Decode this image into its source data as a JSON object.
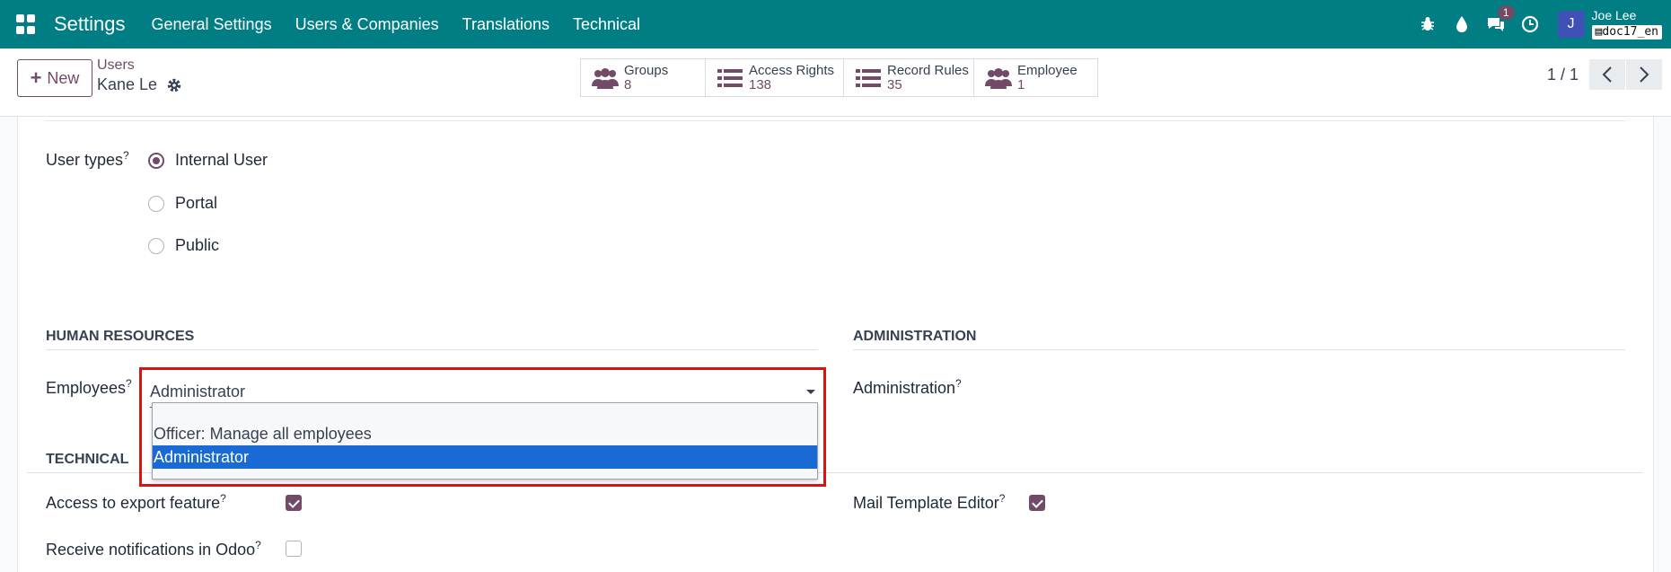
{
  "topbar": {
    "app_title": "Settings",
    "menu": [
      "General Settings",
      "Users & Companies",
      "Translations",
      "Technical"
    ],
    "chat_badge": "1",
    "avatar_letter": "J",
    "user_name": "Joe Lee",
    "db_name": "doc17_en"
  },
  "control": {
    "new_label": "New",
    "breadcrumb_parent": "Users",
    "breadcrumb_current": "Kane Le",
    "smart_buttons": [
      {
        "label": "Groups",
        "value": "8",
        "icon": "users-icon"
      },
      {
        "label": "Access Rights",
        "value": "138",
        "icon": "list-icon"
      },
      {
        "label": "Record Rules",
        "value": "35",
        "icon": "list-icon"
      },
      {
        "label": "Employee",
        "value": "1",
        "icon": "users-icon"
      }
    ],
    "pager": "1 / 1"
  },
  "form": {
    "user_types_label": "User types",
    "user_types_help": "?",
    "user_types": [
      {
        "label": "Internal User",
        "checked": true
      },
      {
        "label": "Portal",
        "checked": false
      },
      {
        "label": "Public",
        "checked": false
      }
    ],
    "hr_section": "HUMAN RESOURCES",
    "admin_section": "ADMINISTRATION",
    "employees_label": "Employees",
    "employees_value": "Administrator",
    "employees_options": [
      "",
      "Officer: Manage all employees",
      "Administrator"
    ],
    "administration_label": "Administration",
    "technical_section": "TECHNICAL",
    "export_label": "Access to export feature",
    "notify_label": "Receive notifications in Odoo",
    "mail_template_label": "Mail Template Editor",
    "help": "?"
  },
  "colors": {
    "topbar": "#017e84",
    "accent": "#714b67",
    "selected": "#1a6ad6",
    "highlight": "#e01010"
  }
}
